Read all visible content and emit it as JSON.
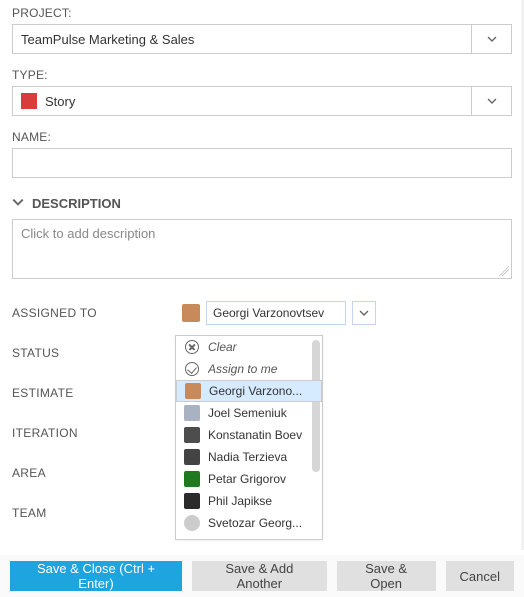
{
  "project": {
    "label": "PROJECT:",
    "value": "TeamPulse Marketing & Sales"
  },
  "type": {
    "label": "TYPE:",
    "value": "Story",
    "color": "#d93c3c"
  },
  "name": {
    "label": "NAME:",
    "value": ""
  },
  "description": {
    "label": "DESCRIPTION",
    "placeholder": "Click to add description"
  },
  "fields": {
    "assigned": {
      "label": "ASSIGNED TO",
      "value": "Georgi Varzonovtsev"
    },
    "status": {
      "label": "STATUS"
    },
    "estimate": {
      "label": "ESTIMATE"
    },
    "iteration": {
      "label": "ITERATION"
    },
    "area": {
      "label": "AREA"
    },
    "team": {
      "label": "TEAM"
    }
  },
  "dropdown": {
    "clear": "Clear",
    "assign_me": "Assign to me",
    "people": [
      {
        "name": "Georgi Varzono...",
        "color": "#c88a5a",
        "selected": true
      },
      {
        "name": "Joel Semeniuk",
        "color": "#a9b2c0"
      },
      {
        "name": "Konstanatin Boev",
        "color": "#4d4d4d"
      },
      {
        "name": "Nadia Terzieva",
        "color": "#444444"
      },
      {
        "name": "Petar Grigorov",
        "color": "#1f7a1f"
      },
      {
        "name": "Phil Japikse",
        "color": "#2b2b2b"
      },
      {
        "name": "Svetozar Georg...",
        "color": "#cccccc"
      }
    ]
  },
  "footer": {
    "save_close": "Save & Close (Ctrl + Enter)",
    "save_add": "Save & Add Another",
    "save_open": "Save & Open",
    "cancel": "Cancel"
  }
}
